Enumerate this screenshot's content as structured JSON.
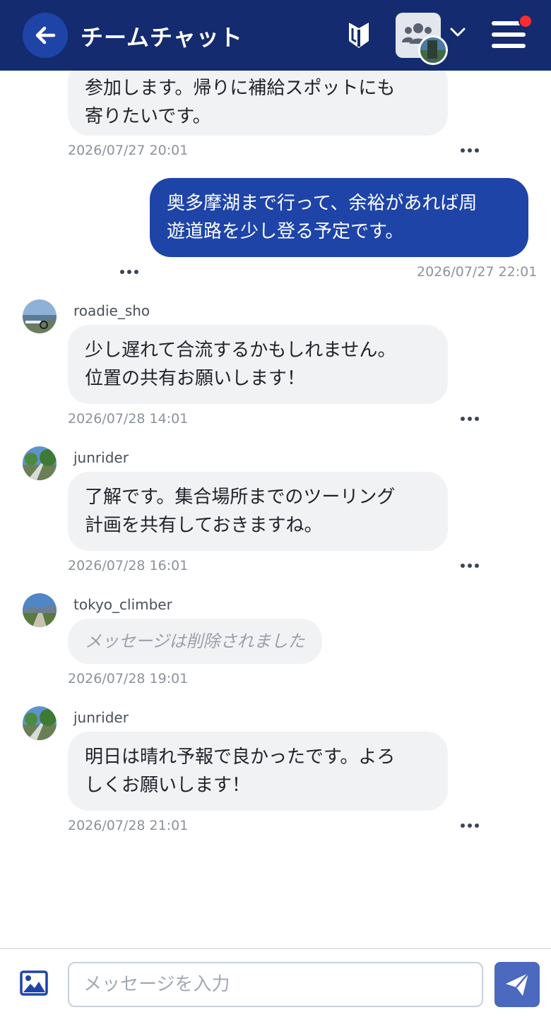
{
  "header": {
    "title": "チームチャット",
    "back_icon": "back-arrow-icon",
    "beginner_icon": "beginner-mark-icon",
    "group_icon": "group-people-icon",
    "menu_icon": "hamburger-menu-icon",
    "colors": {
      "bar": "#142b6f",
      "accent": "#1e44a8",
      "notification": "#ff2d2d"
    }
  },
  "messages": [
    {
      "direction": "in",
      "lines": [
        "参加します。帰りに補給スポットにも",
        "寄りたいです。"
      ],
      "time": "2026/07/27 20:01"
    },
    {
      "direction": "out",
      "lines": [
        "奥多摩湖まで行って、余裕があれば周",
        "遊道路を少し登る予定です。"
      ],
      "time": "2026/07/27 22:01"
    },
    {
      "direction": "in",
      "user": "roadie_sho",
      "lines": [
        "少し遅れて合流するかもしれません。",
        "位置の共有お願いします！"
      ],
      "time": "2026/07/28 14:01"
    },
    {
      "direction": "in",
      "user": "junrider",
      "lines": [
        "了解です。集合場所までのツーリング",
        "計画を共有しておきますね。"
      ],
      "time": "2026/07/28 16:01"
    },
    {
      "direction": "in",
      "user": "tokyo_climber",
      "deleted": true,
      "lines": [
        "メッセージは削除されました"
      ],
      "time": "2026/07/28 19:01"
    },
    {
      "direction": "in",
      "user": "junrider",
      "lines": [
        "明日は晴れ予報で良かったです。よろ",
        "しくお願いします！"
      ],
      "time": "2026/07/28 21:01"
    }
  ],
  "composer": {
    "placeholder": "メッセージを入力",
    "value": "",
    "image_icon": "image-icon",
    "send_icon": "send-icon"
  }
}
